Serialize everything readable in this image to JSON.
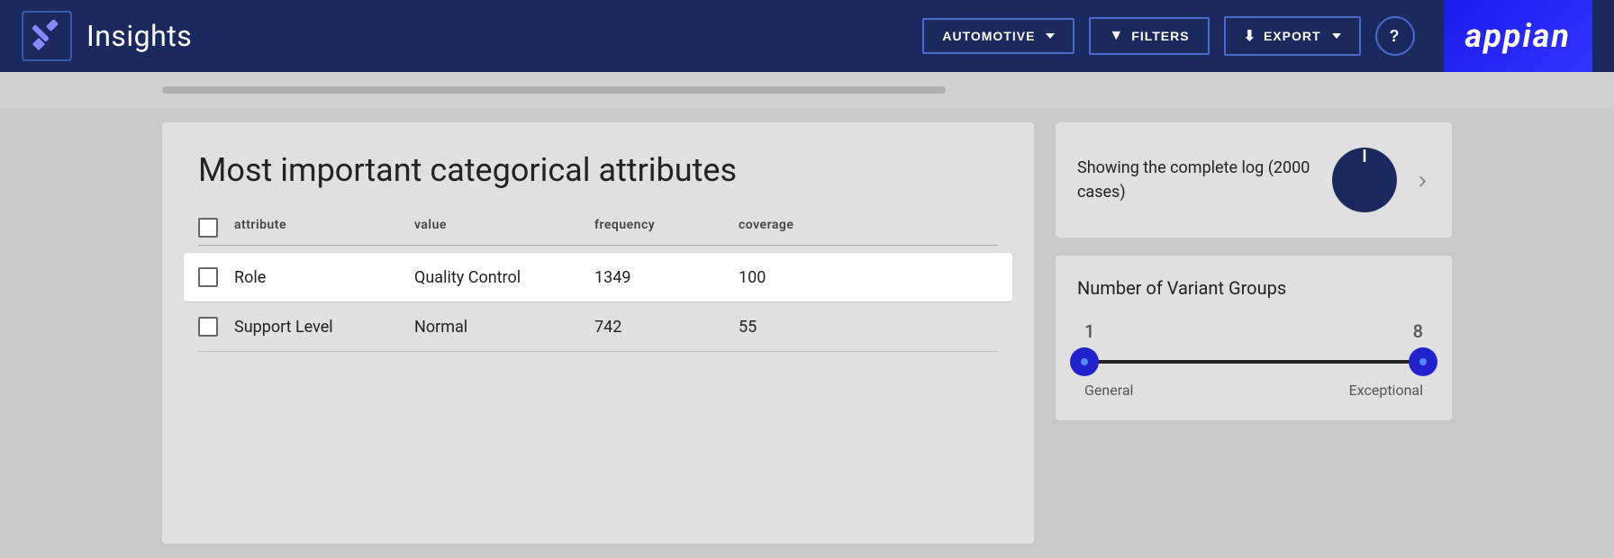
{
  "header": {
    "title": "Insights",
    "logo_alt": "hammer-icon",
    "automotive_label": "AUTOMOTIVE",
    "filters_label": "FILTERS",
    "export_label": "EXPORT",
    "help_label": "?",
    "appian_label": "appian"
  },
  "main": {
    "panel_title": "Most important categorical attributes",
    "table": {
      "columns": [
        "",
        "attribute",
        "value",
        "frequency",
        "coverage"
      ],
      "rows": [
        {
          "attribute": "Role",
          "value": "Quality Control",
          "frequency": "1349",
          "coverage": "100",
          "highlighted": true
        },
        {
          "attribute": "Support Level",
          "value": "Normal",
          "frequency": "742",
          "coverage": "55",
          "highlighted": false
        }
      ]
    }
  },
  "sidebar": {
    "log_info_text": "Showing the complete log (2000 cases)",
    "chevron_right": "›",
    "variant_title": "Number of Variant Groups",
    "slider_min": "1",
    "slider_max": "8",
    "slider_label_left": "General",
    "slider_label_right": "Exceptional"
  }
}
